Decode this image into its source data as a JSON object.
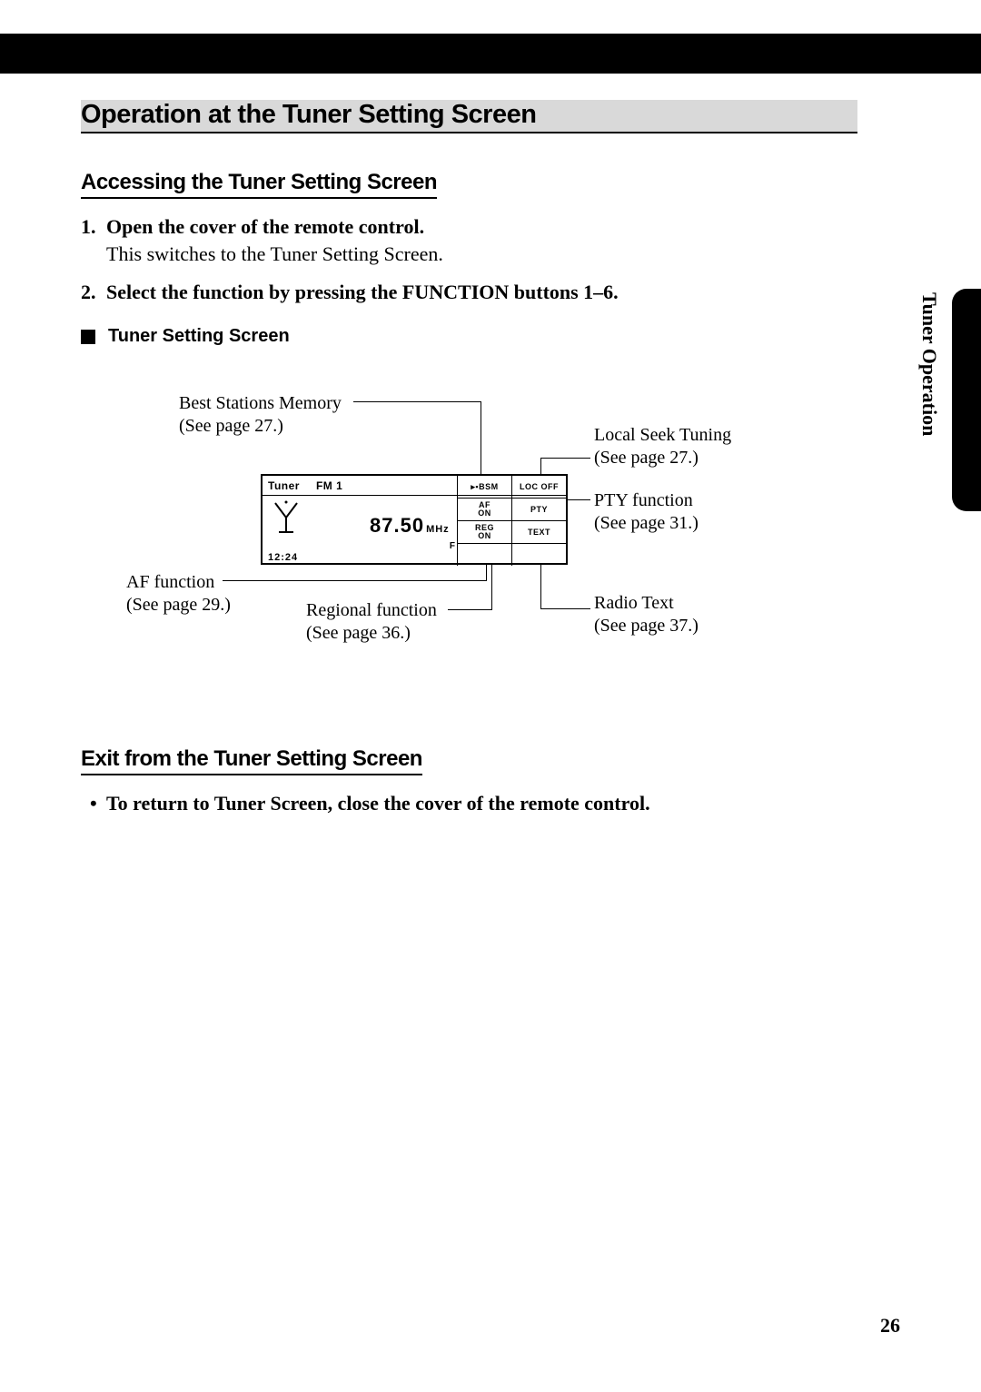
{
  "header": {
    "title": "Operation at the Tuner Setting Screen"
  },
  "section1": {
    "title": "Accessing the Tuner Setting Screen",
    "steps": [
      {
        "num": "1.",
        "head": "Open the cover of the remote control.",
        "body": "This switches to the Tuner Setting Screen."
      },
      {
        "num": "2.",
        "head": "Select the function by pressing the FUNCTION buttons 1–6.",
        "body": ""
      }
    ],
    "sub": "Tuner Setting Screen"
  },
  "diagram": {
    "callouts": {
      "bsm": {
        "label": "Best Stations Memory",
        "pref": "(See page 27.)"
      },
      "local": {
        "label": "Local Seek Tuning",
        "pref": "(See page 27.)"
      },
      "pty": {
        "label": "PTY function",
        "pref": "(See page 31.)"
      },
      "af": {
        "label": "AF function",
        "pref": "(See page 29.)"
      },
      "reg": {
        "label": "Regional function",
        "pref": "(See page 36.)"
      },
      "text": {
        "label": "Radio Text",
        "pref": "(See page 37.)"
      }
    },
    "device": {
      "tuner_label": "Tuner",
      "band": "FM 1",
      "frequency": "87.50",
      "freq_unit": "MHz",
      "clock": "12:24",
      "f_indicator": "F",
      "cells": {
        "bsm": "▸▪BSM",
        "loc": "LOC OFF",
        "af": "AF\nON",
        "pty": "PTY",
        "reg": "REG\nON",
        "txt": "TEXT"
      }
    }
  },
  "section2": {
    "title": "Exit from the Tuner Setting Screen",
    "bullet": "To return to Tuner Screen, close the cover of the remote control."
  },
  "side_label": "Tuner Operation",
  "page_number": "26"
}
